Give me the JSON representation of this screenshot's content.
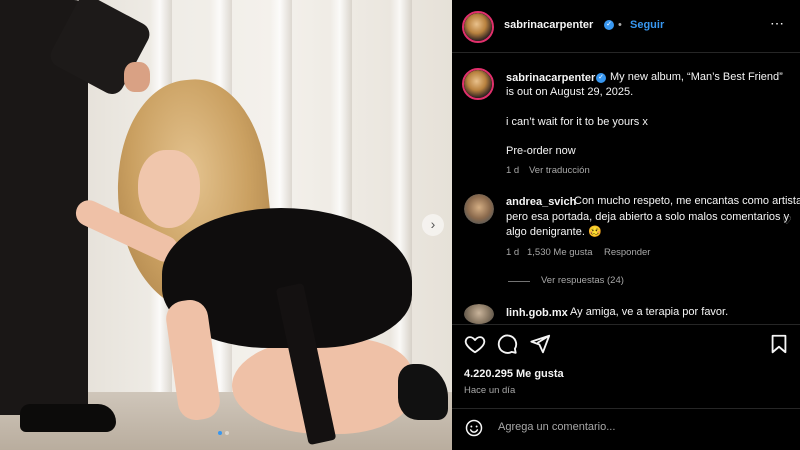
{
  "post": {
    "image_next_icon": "chevron-right-icon",
    "carousel_dot_count": 2,
    "carousel_active_index": 1
  },
  "header": {
    "username": "sabrinacarpenter",
    "separator": "•",
    "follow_label": "Seguir",
    "more_icon": "more-horizontal-icon"
  },
  "caption": {
    "username": "sabrinacarpenter",
    "text_line1": "My new album, “Man’s Best Friend” ",
    "text_line2": "is out on August 29, 2025.",
    "text_line3": "i can’t wait for it to be yours x",
    "text_line4": "Pre-order now",
    "time": "1 d",
    "translate_label": "Ver traducción"
  },
  "comments": [
    {
      "username": "andrea_svich",
      "line1": "Con mucho respeto, me encantas como artista",
      "line2": "pero esa portada, deja abierto a solo malos comentarios y",
      "line3": "algo denigrante. 🥴",
      "time": "1 d",
      "likes": "1,530 Me gusta",
      "reply_label": "Responder",
      "view_replies_label": "Ver respuestas (24)"
    },
    {
      "username": "linh.gob.mx",
      "line1": "Ay amiga, ve a terapia por favor."
    }
  ],
  "actions": {
    "like_icon": "heart-icon",
    "comment_icon": "comment-icon",
    "share_icon": "send-icon",
    "likes_count": "4.220.295 Me gusta",
    "posted": "Hace un día"
  },
  "composer": {
    "emoji_icon": "emoji-icon",
    "placeholder": "Agrega un comentario..."
  },
  "colors": {
    "accent": "#3897f0",
    "background": "#000000",
    "story_ring": "#e1306c"
  }
}
